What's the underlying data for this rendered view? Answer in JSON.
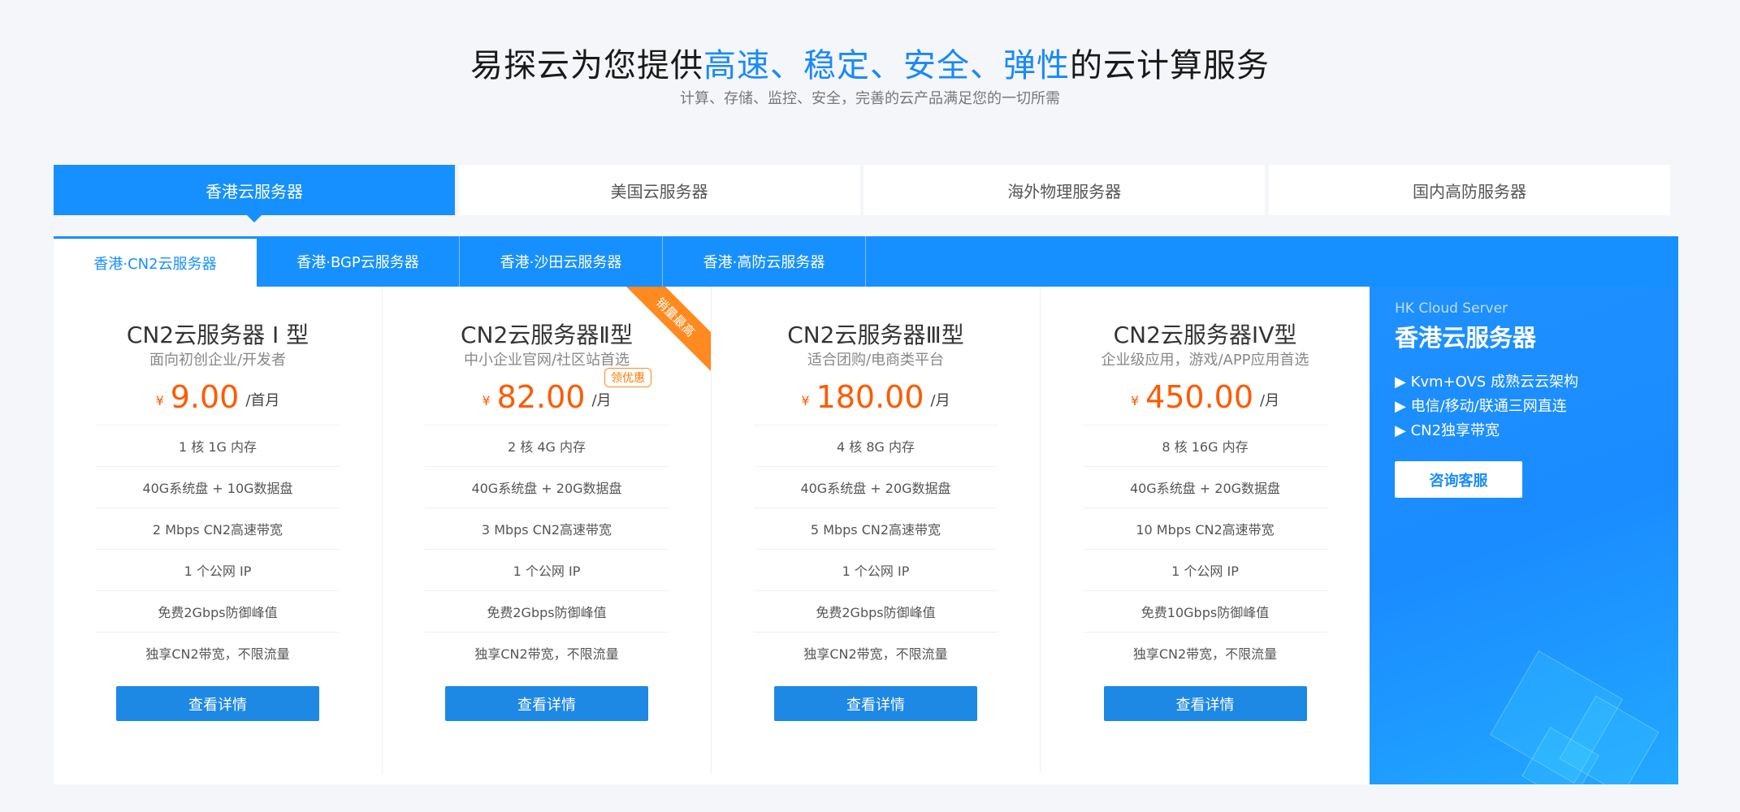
{
  "hero": {
    "title_pre": "易探云为您提供",
    "hl1": "高速",
    "sep1": "、",
    "hl2": "稳定",
    "sep2": "、",
    "hl3": "安全",
    "sep3": "、",
    "hl4": "弹性",
    "title_post": "的云计算服务",
    "subtitle": "计算、存储、监控、安全，完善的云产品满足您的一切所需"
  },
  "main_tabs": [
    "香港云服务器",
    "美国云服务器",
    "海外物理服务器",
    "国内高防服务器"
  ],
  "sub_tabs": [
    "香港·CN2云服务器",
    "香港·BGP云服务器",
    "香港·沙田云服务器",
    "香港·高防云服务器"
  ],
  "cards": [
    {
      "name": "CN2云服务器 I 型",
      "desc": "面向初创企业/开发者",
      "currency": "¥",
      "price": "9.00",
      "unit": "/首月",
      "specs": [
        "1 核 1G 内存",
        "40G系统盘 + 10G数据盘",
        "2 Mbps CN2高速带宽",
        "1 个公网 IP",
        "免费2Gbps防御峰值",
        "独享CN2带宽，不限流量"
      ],
      "button": "查看详情"
    },
    {
      "name": "CN2云服务器Ⅱ型",
      "desc": "中小企业官网/社区站首选",
      "currency": "¥",
      "price": "82.00",
      "unit": "/月",
      "coupon": "领优惠",
      "ribbon": "销量最高",
      "specs": [
        "2 核 4G 内存",
        "40G系统盘 + 20G数据盘",
        "3 Mbps CN2高速带宽",
        "1 个公网 IP",
        "免费2Gbps防御峰值",
        "独享CN2带宽，不限流量"
      ],
      "button": "查看详情"
    },
    {
      "name": "CN2云服务器Ⅲ型",
      "desc": "适合团购/电商类平台",
      "currency": "¥",
      "price": "180.00",
      "unit": "/月",
      "specs": [
        "4 核 8G 内存",
        "40G系统盘 + 20G数据盘",
        "5 Mbps CN2高速带宽",
        "1 个公网 IP",
        "免费2Gbps防御峰值",
        "独享CN2带宽，不限流量"
      ],
      "button": "查看详情"
    },
    {
      "name": "CN2云服务器IV型",
      "desc": "企业级应用，游戏/APP应用首选",
      "currency": "¥",
      "price": "450.00",
      "unit": "/月",
      "specs": [
        "8 核 16G 内存",
        "40G系统盘 + 20G数据盘",
        "10 Mbps CN2高速带宽",
        "1 个公网 IP",
        "免费10Gbps防御峰值",
        "独享CN2带宽，不限流量"
      ],
      "button": "查看详情"
    }
  ],
  "promo": {
    "en": "HK Cloud Server",
    "title": "香港云服务器",
    "features": [
      "▶ Kvm+OVS 成熟云云架构",
      "▶ 电信/移动/联通三网直连",
      "▶ CN2独享带宽"
    ],
    "button": "咨询客服"
  },
  "colors": {
    "accent": "#1690ff",
    "price": "#ff5a00",
    "ribbon": "#ff8a1f"
  }
}
